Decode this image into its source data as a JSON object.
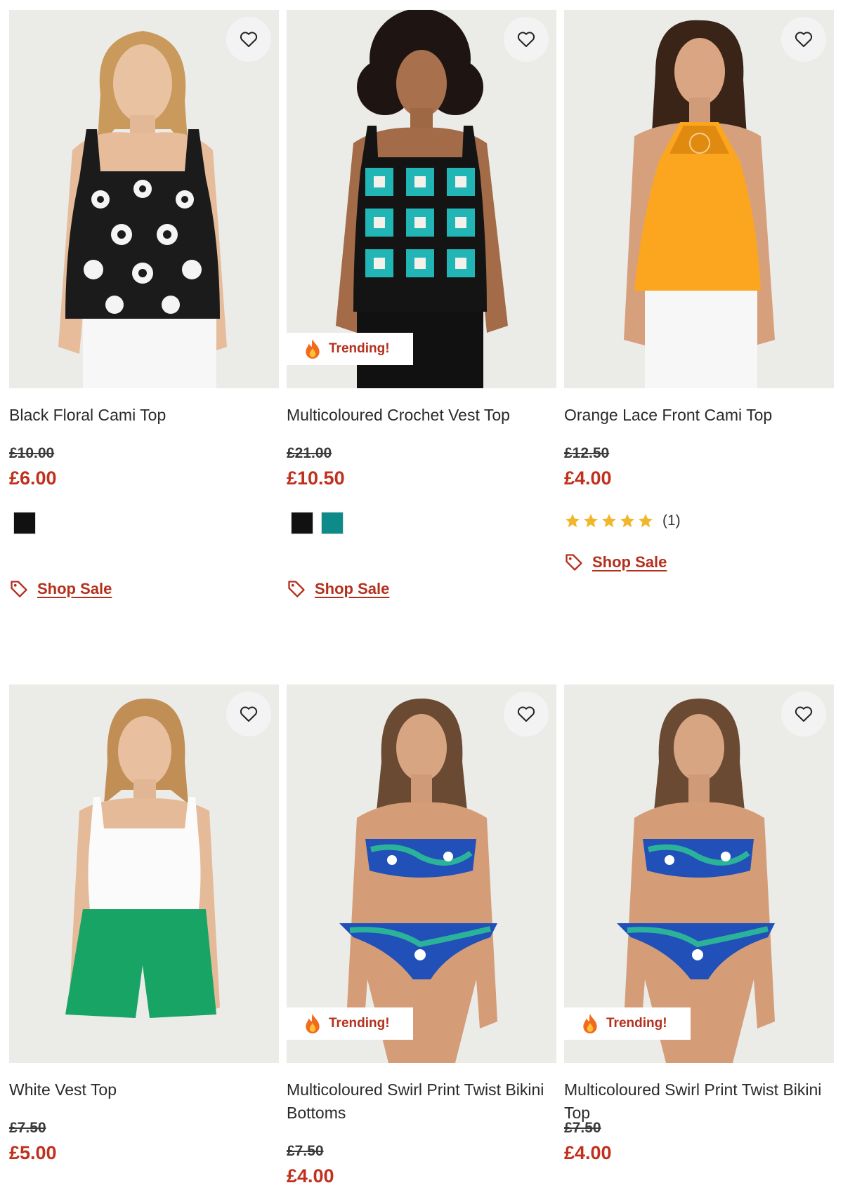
{
  "colors": {
    "price": "#c1301d",
    "link": "#b4301d",
    "star": "#f2b62b"
  },
  "products": [
    {
      "title": "Black Floral Cami Top",
      "was_price": "£10.00",
      "price": "£6.00",
      "swatches": [
        "#111111"
      ],
      "badge": "",
      "shop_sale": "Shop Sale"
    },
    {
      "title": "Multicoloured Crochet Vest Top",
      "was_price": "£21.00",
      "price": "£10.50",
      "swatches": [
        "#111111",
        "#0d8a8a"
      ],
      "badge": "Trending!",
      "shop_sale": "Shop Sale"
    },
    {
      "title": "Orange Lace Front Cami Top",
      "was_price": "£12.50",
      "price": "£4.00",
      "rating": 5,
      "rating_count": "(1)",
      "badge": "",
      "shop_sale": "Shop Sale"
    },
    {
      "title": "White Vest Top",
      "was_price": "£7.50",
      "price": "£5.00",
      "badge": ""
    },
    {
      "title": "Multicoloured Swirl Print Twist Bikini Bottoms",
      "was_price": "£7.50",
      "price": "£4.00",
      "badge": "Trending!"
    },
    {
      "title": "Multicoloured Swirl Print Twist Bikini Top",
      "was_price": "£7.50",
      "price": "£4.00",
      "badge": "Trending!"
    }
  ]
}
